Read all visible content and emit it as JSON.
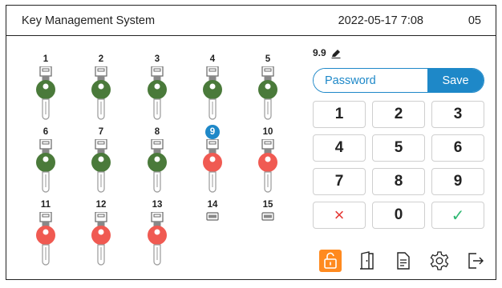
{
  "header": {
    "title": "Key Management System",
    "datetime": "2022-05-17 7:08",
    "slot_count": "05"
  },
  "slots": [
    {
      "number": "1",
      "state": "green"
    },
    {
      "number": "2",
      "state": "green"
    },
    {
      "number": "3",
      "state": "green"
    },
    {
      "number": "4",
      "state": "green"
    },
    {
      "number": "5",
      "state": "green"
    },
    {
      "number": "6",
      "state": "green"
    },
    {
      "number": "7",
      "state": "green"
    },
    {
      "number": "8",
      "state": "green"
    },
    {
      "number": "9",
      "state": "red",
      "selected": true
    },
    {
      "number": "10",
      "state": "red"
    },
    {
      "number": "11",
      "state": "red"
    },
    {
      "number": "12",
      "state": "red"
    },
    {
      "number": "13",
      "state": "red"
    },
    {
      "number": "14",
      "state": "empty"
    },
    {
      "number": "15",
      "state": "empty"
    }
  ],
  "panel": {
    "edit_label": "9.9",
    "password_placeholder": "Password",
    "save_label": "Save",
    "keys": [
      "1",
      "2",
      "3",
      "4",
      "5",
      "6",
      "7",
      "8",
      "9",
      "×",
      "0",
      "✓"
    ]
  },
  "toolbar": {
    "icons": [
      "unlock-icon",
      "door-icon",
      "document-icon",
      "settings-gear-icon",
      "logout-icon"
    ]
  },
  "colors": {
    "accent_blue": "#1e88c8",
    "key_green": "#4a7a3a",
    "key_red": "#f05a52",
    "active_orange": "#ff8a1f",
    "cancel_red": "#e53935",
    "confirm_green": "#2eb872"
  }
}
